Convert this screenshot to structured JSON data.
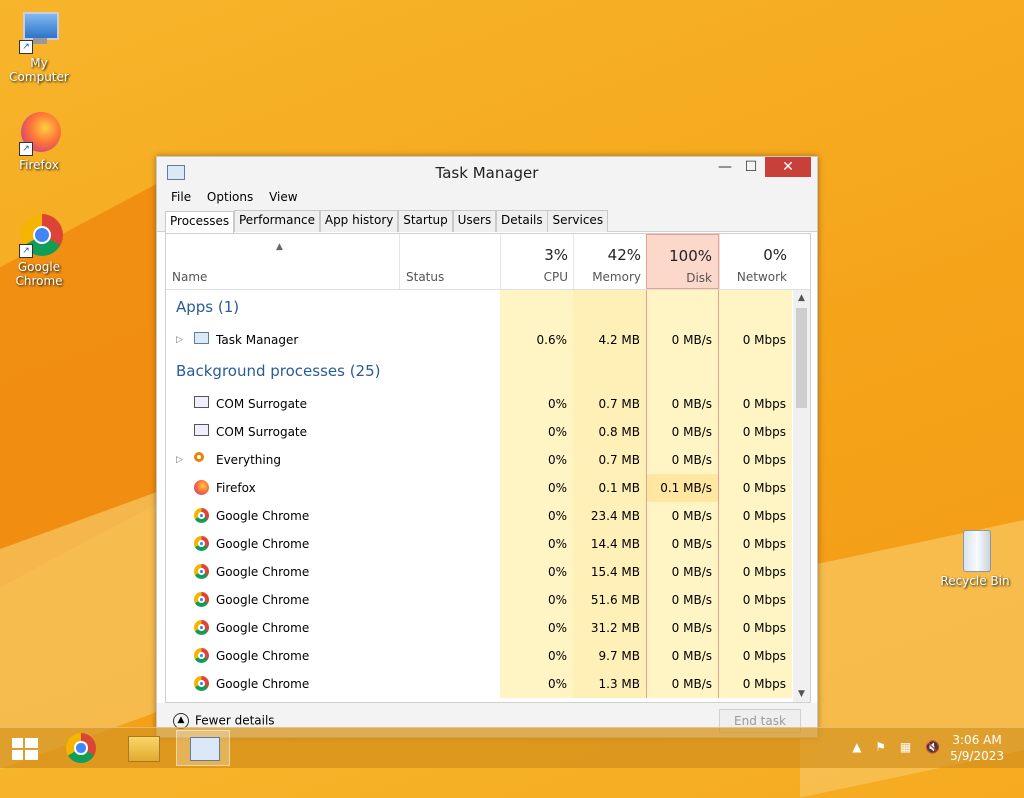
{
  "desktop": {
    "icons": [
      {
        "label": "My Computer",
        "icon": "computer-icon"
      },
      {
        "label": "Firefox",
        "icon": "firefox-icon"
      },
      {
        "label": "Google Chrome",
        "icon": "chrome-icon"
      },
      {
        "label": "Recycle Bin",
        "icon": "recycle-bin-icon"
      }
    ]
  },
  "window": {
    "title": "Task Manager",
    "min_glyph": "—",
    "max_glyph": "☐",
    "close_glyph": "✕",
    "menu": [
      "File",
      "Options",
      "View"
    ],
    "tabs": [
      "Processes",
      "Performance",
      "App history",
      "Startup",
      "Users",
      "Details",
      "Services"
    ],
    "active_tab": "Processes"
  },
  "columns": {
    "name": "Name",
    "status": "Status",
    "cpu": {
      "pct": "3%",
      "label": "CPU"
    },
    "memory": {
      "pct": "42%",
      "label": "Memory"
    },
    "disk": {
      "pct": "100%",
      "label": "Disk"
    },
    "network": {
      "pct": "0%",
      "label": "Network"
    }
  },
  "groups": {
    "apps": "Apps (1)",
    "background": "Background processes (25)"
  },
  "apps": [
    {
      "name": "Task Manager",
      "cpu": "0.6%",
      "mem": "4.2 MB",
      "disk": "0 MB/s",
      "net": "0 Mbps",
      "icon": "task-manager-icon",
      "expandable": true
    }
  ],
  "background": [
    {
      "name": "COM Surrogate",
      "cpu": "0%",
      "mem": "0.7 MB",
      "disk": "0 MB/s",
      "net": "0 Mbps",
      "icon": "window-icon",
      "expandable": false
    },
    {
      "name": "COM Surrogate",
      "cpu": "0%",
      "mem": "0.8 MB",
      "disk": "0 MB/s",
      "net": "0 Mbps",
      "icon": "window-icon",
      "expandable": false
    },
    {
      "name": "Everything",
      "cpu": "0%",
      "mem": "0.7 MB",
      "disk": "0 MB/s",
      "net": "0 Mbps",
      "icon": "magnifier-icon",
      "expandable": true
    },
    {
      "name": "Firefox",
      "cpu": "0%",
      "mem": "0.1 MB",
      "disk": "0.1 MB/s",
      "net": "0 Mbps",
      "icon": "firefox-icon",
      "expandable": false
    },
    {
      "name": "Google Chrome",
      "cpu": "0%",
      "mem": "23.4 MB",
      "disk": "0 MB/s",
      "net": "0 Mbps",
      "icon": "chrome-icon",
      "expandable": false
    },
    {
      "name": "Google Chrome",
      "cpu": "0%",
      "mem": "14.4 MB",
      "disk": "0 MB/s",
      "net": "0 Mbps",
      "icon": "chrome-icon",
      "expandable": false
    },
    {
      "name": "Google Chrome",
      "cpu": "0%",
      "mem": "15.4 MB",
      "disk": "0 MB/s",
      "net": "0 Mbps",
      "icon": "chrome-icon",
      "expandable": false
    },
    {
      "name": "Google Chrome",
      "cpu": "0%",
      "mem": "51.6 MB",
      "disk": "0 MB/s",
      "net": "0 Mbps",
      "icon": "chrome-icon",
      "expandable": false
    },
    {
      "name": "Google Chrome",
      "cpu": "0%",
      "mem": "31.2 MB",
      "disk": "0 MB/s",
      "net": "0 Mbps",
      "icon": "chrome-icon",
      "expandable": false
    },
    {
      "name": "Google Chrome",
      "cpu": "0%",
      "mem": "9.7 MB",
      "disk": "0 MB/s",
      "net": "0 Mbps",
      "icon": "chrome-icon",
      "expandable": false
    },
    {
      "name": "Google Chrome",
      "cpu": "0%",
      "mem": "1.3 MB",
      "disk": "0 MB/s",
      "net": "0 Mbps",
      "icon": "chrome-icon",
      "expandable": false
    }
  ],
  "footer": {
    "fewer": "Fewer details",
    "end_task": "End task"
  },
  "taskbar": {
    "items": [
      "start-icon",
      "chrome-icon",
      "file-explorer-icon",
      "task-manager-icon"
    ],
    "time": "3:06 AM",
    "date": "5/9/2023"
  }
}
